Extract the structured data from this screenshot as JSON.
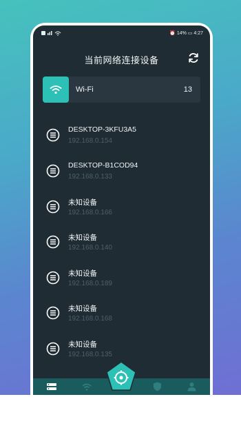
{
  "status": {
    "left": "Ⓜ ᴴᴰ .ıl ⌒",
    "battery": "14%",
    "time": "4:27"
  },
  "header": {
    "title": "当前网络连接设备"
  },
  "wifi": {
    "label": "Wi-Fi",
    "count": "13"
  },
  "devices": [
    {
      "name": "DESKTOP-3KFU3A5",
      "ip": "192.168.0.154"
    },
    {
      "name": "DESKTOP-B1COD94",
      "ip": "192.168.0.133"
    },
    {
      "name": "未知设备",
      "ip": "192.168.0.166"
    },
    {
      "name": "未知设备",
      "ip": "192.168.0.140"
    },
    {
      "name": "未知设备",
      "ip": "192.168.0.189"
    },
    {
      "name": "未知设备",
      "ip": "192.168.0.168"
    },
    {
      "name": "未知设备",
      "ip": "192.168.0.135"
    }
  ],
  "icons": {
    "refresh": "refresh-icon",
    "wifi": "wifi-icon",
    "device": "device-icon",
    "tabs": [
      "list-icon",
      "wifi-icon",
      "target-icon",
      "shield-icon",
      "person-icon"
    ]
  },
  "colors": {
    "background_top": "#46c2bd",
    "background_bottom": "#6f6fd4",
    "screen": "#1f2c34",
    "card": "#2a3740",
    "accent": "#2cc0b7",
    "ip_text": "#4f5f68",
    "tabbar": "#1a5b5e"
  }
}
